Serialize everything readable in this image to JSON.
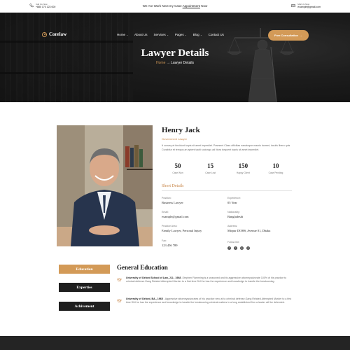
{
  "topbar": {
    "call_label": "Call Us Now",
    "phone": "+880 170 123 000",
    "notice_text": "We Are Work Next my Case",
    "notice_link": "Appointment",
    "notice_suffix": "Now",
    "mail_label": "Mail Us Now",
    "email": "example@gmail.com"
  },
  "nav": {
    "logo": "Corelaw",
    "items": [
      "Home",
      "About Us",
      "Services",
      "Pages",
      "Blog",
      "Contact Us"
    ],
    "cta": "Free Consultation"
  },
  "hero": {
    "title": "Lawyer Details",
    "crumb_home": "Home",
    "crumb_current": "Lawyer Details"
  },
  "profile": {
    "name": "Henry Jack",
    "role": "Government Lawyer",
    "bio": "It convey et tincidunt turpis sit amet imperdiet. Praesent Class officiitas nanatoque mauris laoreet, iaculis libero quis Curabitur et tempus an aptent taciti sociosqu ad litora torquent turpis sit amet imperdiet.",
    "stats": [
      {
        "value": "50",
        "label": "Case Won"
      },
      {
        "value": "15",
        "label": "Case Lost"
      },
      {
        "value": "150",
        "label": "Happy Client"
      },
      {
        "value": "10",
        "label": "Case Pending"
      }
    ],
    "short_details_title": "Short Details",
    "fields": {
      "position_label": "Position:",
      "position": "Business Lawyer",
      "experience_label": "Experience:",
      "experience": "05 Year",
      "email_label": "Email:",
      "email": "example@gmail.com",
      "nationality_label": "Nationality:",
      "nationality": "Bangladeshi",
      "practice_label": "Practice Area:",
      "practice": "Family Lawyer, Personal Injury",
      "address_label": "Address:",
      "address": "Mirpur DOHS, Avenue 01, Dhaka",
      "fax_label": "Fax:",
      "fax": "123 456 789",
      "follow_label": "Follow Me:"
    },
    "socials": [
      "facebook-icon",
      "twitter-icon",
      "instagram-icon",
      "pinterest-icon"
    ]
  },
  "tabs": [
    "Education",
    "Experties",
    "Achivement"
  ],
  "education": {
    "title": "General Education",
    "items": [
      {
        "head": "University of Oxford School of Law, J.D., 1968",
        "body": " -Stephen Flamming is a seasoned and its aggressive attorneyadvorate 100% of his practice to criminal defense.Gang Related Attempted Murder to a first time DUI he has the experience and knowledge to handle the breaksoning."
      },
      {
        "head": "University of Oxford, BA., 1965",
        "body": " - Aggressive attorneyadvorates of his practice vero at to criminal defense.Gang Related Attempted Murder to a first time DUI he has the experience and knowledge to handle the breaksoning criminal matters in a long established firm a leader will be defended."
      }
    ]
  },
  "colors": {
    "accent": "#d39a57",
    "dark": "#1f1f1f"
  }
}
